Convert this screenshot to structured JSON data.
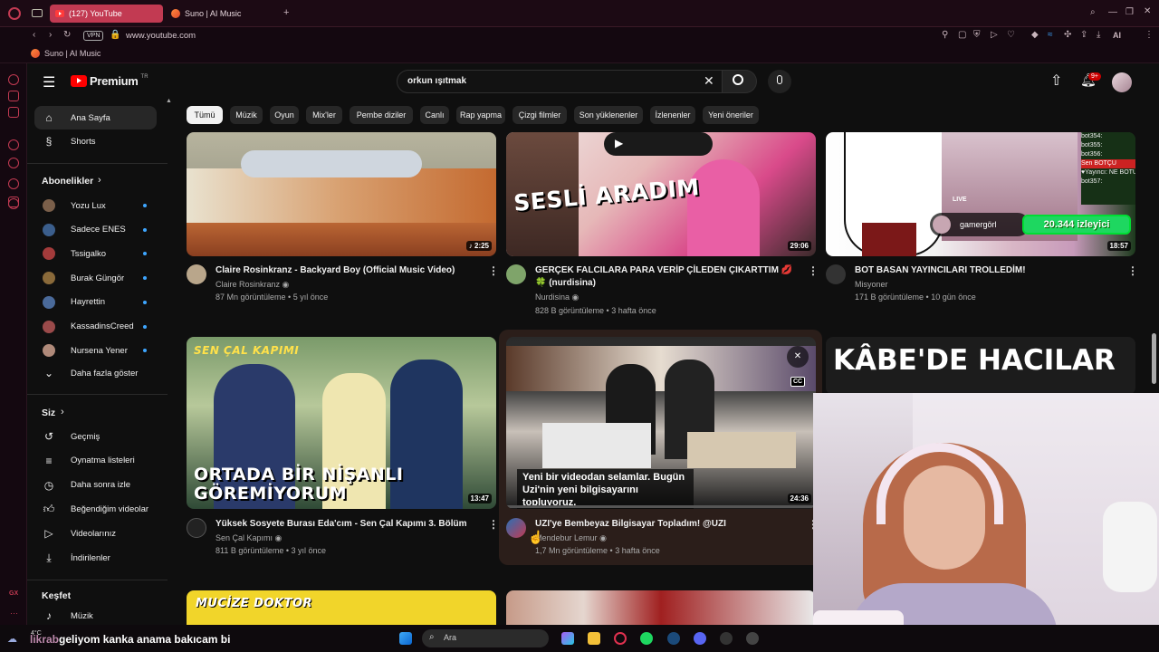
{
  "browser": {
    "tabs": [
      {
        "label": "(127) YouTube"
      },
      {
        "label": "Suno | AI Music"
      }
    ],
    "new_tab": "+",
    "vpn_label": "VPN",
    "url": "www.youtube.com",
    "bookmark": "Suno | AI Music",
    "toolbar_ai": "AI"
  },
  "youtube": {
    "logo": "Premium",
    "logo_region": "TR",
    "search": {
      "value": "orkun ışıtmak"
    },
    "notifications_badge": "9+"
  },
  "sidebar": {
    "main": [
      {
        "label": "Ana Sayfa",
        "icon": "home-icon"
      },
      {
        "label": "Shorts",
        "icon": "shorts-icon"
      }
    ],
    "subscriptions_header": "Abonelikler",
    "subscriptions": [
      {
        "label": "Yozu Lux",
        "color": "#7a5f4a"
      },
      {
        "label": "Sadece ENES",
        "color": "#3b5e8c"
      },
      {
        "label": "Tssigalko",
        "color": "#a33b3b"
      },
      {
        "label": "Burak Güngör",
        "color": "#8a6a3a"
      },
      {
        "label": "Hayrettin",
        "color": "#4a6a9a"
      },
      {
        "label": "KassadinsCreed",
        "color": "#9a4a4a"
      },
      {
        "label": "Nursena Yener",
        "color": "#b08a7a"
      }
    ],
    "show_more": "Daha fazla göster",
    "you_header": "Siz",
    "you": [
      {
        "label": "Geçmiş",
        "icon": "history-icon"
      },
      {
        "label": "Oynatma listeleri",
        "icon": "playlist-icon"
      },
      {
        "label": "Daha sonra izle",
        "icon": "clock-icon"
      },
      {
        "label": "Beğendiğim videolar",
        "icon": "like-icon"
      },
      {
        "label": "Videolarınız",
        "icon": "video-icon"
      },
      {
        "label": "İndirilenler",
        "icon": "download-icon"
      }
    ],
    "explore_header": "Keşfet",
    "explore": [
      {
        "label": "Müzik",
        "icon": "music-icon"
      }
    ]
  },
  "chips": [
    "Tümü",
    "Müzik",
    "Oyun",
    "Mix'ler",
    "Pembe diziler",
    "Canlı",
    "Rap yapma",
    "Çizgi filmler",
    "Son yüklenenler",
    "İzlenenler",
    "Yeni öneriler"
  ],
  "videos": [
    {
      "title": "Claire Rosinkranz - Backyard Boy (Official Music Video)",
      "channel": "Claire Rosinkranz",
      "meta": "87 Mn görüntüleme • 5 yıl önce",
      "duration": "♪ 2:25"
    },
    {
      "title": "GERÇEK FALCILARA PARA VERİP ÇİLEDEN ÇIKARTTIM 💋🍀 (nurdisina)",
      "channel": "Nurdisina",
      "meta": "828 B görüntüleme • 3 hafta önce",
      "duration": "29:06",
      "overlay": "SESLİ ARADIM"
    },
    {
      "title": "BOT BASAN YAYINCILARI TROLLEDİM!",
      "channel": "Misyoner",
      "meta": "171 B görüntüleme • 10 gün önce",
      "duration": "18:57",
      "live": "LIVE",
      "streamer": "gamergörl",
      "viewers": "20.344 izleyici",
      "chat": [
        "bot354:",
        "bot355:",
        "bot356:",
        "Sen BOTÇU",
        "♥Yayıncı: NE BOTU YA!?",
        "bot357:"
      ]
    },
    {
      "title": "Yüksek Sosyete Burası Eda'cım - Sen Çal Kapımı 3. Bölüm",
      "channel": "Sen Çal Kapımı",
      "meta": "811 B görüntüleme • 3 yıl önce",
      "duration": "13:47",
      "brand": "SEN ÇAL KAPIMI",
      "overlay": "ORTADA BİR NİŞANLI GÖREMİYORUM"
    },
    {
      "title": "UZI'ye Bembeyaz Bilgisayar Topladım! @UZI",
      "channel": "Mendebur Lemur",
      "meta": "1,7 Mn görüntüleme • 3 hafta önce",
      "duration": "24:36",
      "caption": "Yeni bir videodan selamlar. Bugün Uzi'nin yeni bilgisayarını topluyoruz.",
      "cc": "CC"
    },
    {
      "title": "",
      "channel": "",
      "meta": "",
      "duration": "",
      "overlay": "KÂBE'DE HACILAR"
    }
  ],
  "row3": [
    {
      "overlay": "MUCİZE DOKTOR"
    }
  ],
  "taskbar": {
    "weather_temp": "4°C",
    "ticker": "geliyom kanka anama bakıcam bi",
    "ticker_prefix": "likrab",
    "search_placeholder": "Ara"
  }
}
